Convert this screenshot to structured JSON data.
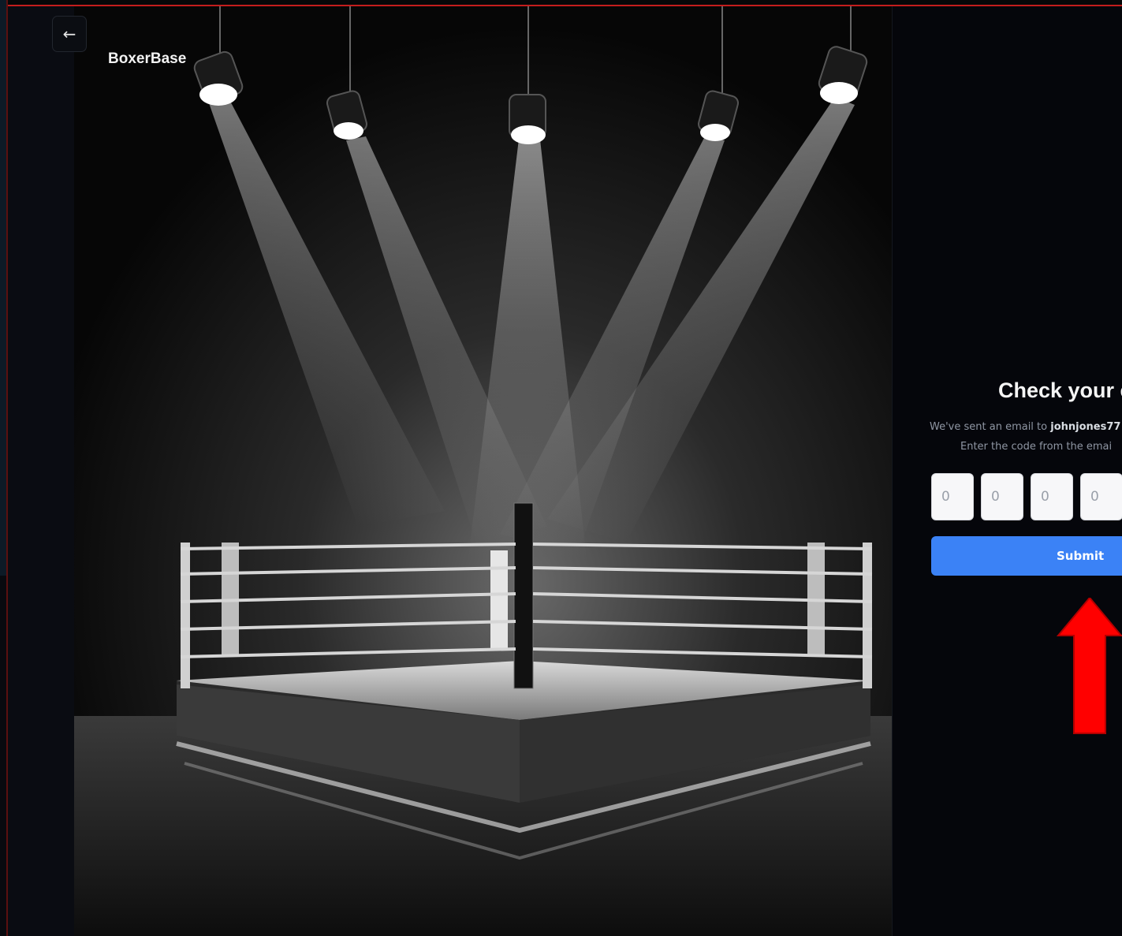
{
  "app": {
    "brand": "BoxerBase"
  },
  "nav": {
    "back_icon": "arrow-left-icon",
    "back_glyph": "←"
  },
  "verify": {
    "title": "Check your er",
    "line1_prefix": "We've sent an email to ",
    "email": "johnjones77",
    "line2": "Enter the code from the emai",
    "code_digits": [
      {
        "placeholder": "0"
      },
      {
        "placeholder": "0"
      },
      {
        "placeholder": "0"
      },
      {
        "placeholder": "0"
      }
    ],
    "submit_label": "Submit"
  },
  "colors": {
    "accent": "#3b82f6",
    "annotation_arrow": "#ff0000",
    "frame_red": "#c41d1d"
  },
  "annotation": {
    "icon": "red-arrow-up-icon"
  }
}
